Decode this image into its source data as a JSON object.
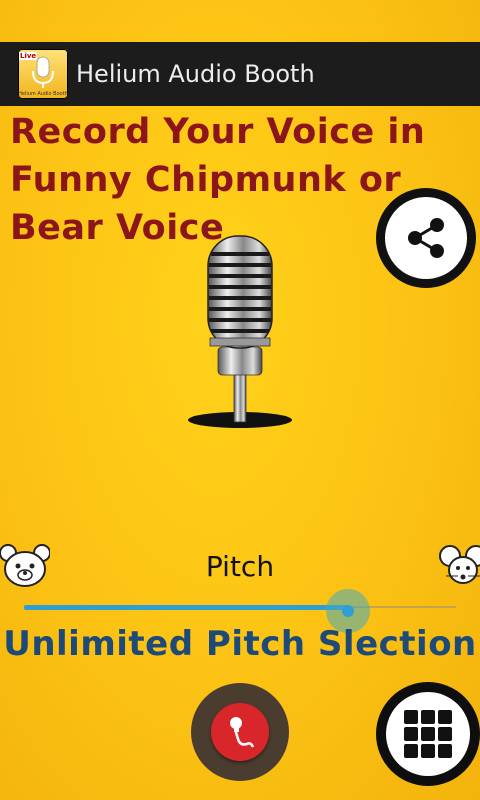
{
  "app": {
    "title": "Helium Audio Booth",
    "icon_name": "helium-audio-booth-app-icon",
    "icon_badge": "Live",
    "icon_caption": "Helium Audio Booth"
  },
  "headline": "Record Your Voice in\nFunny Chipmunk or\nBear Voice",
  "share": {
    "icon": "share-icon"
  },
  "microphone": {
    "icon": "microphone-icon"
  },
  "pitch": {
    "label": "Pitch",
    "low_icon": "bear-icon",
    "high_icon": "mouse-icon",
    "value_fraction": 0.75
  },
  "tagline": "Unlimited Pitch Slection",
  "bottom": {
    "record_icon": "record-microphone-icon",
    "menu_icon": "grid-menu-icon"
  },
  "colors": {
    "background": "#fdc515",
    "headline": "#8b1518",
    "tagline": "#1d4a78",
    "slider": "#2f9fd3",
    "record": "#d8262b"
  }
}
